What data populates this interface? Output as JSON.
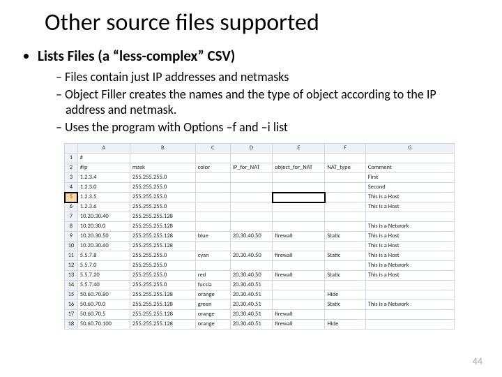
{
  "title": "Other source files supported",
  "bullet_main": "Lists Files (a “less-complex” CSV)",
  "sub_bullets": {
    "b1": "Files contain just IP addresses and netmasks",
    "b2": "Object Filler creates the names and the type of object according to the IP address and netmask.",
    "b3": "Uses the program with Options –f and –i list"
  },
  "page_number": "44",
  "sheet": {
    "cols": [
      "A",
      "B",
      "C",
      "D",
      "E",
      "F",
      "G"
    ],
    "row_numbers": [
      "1",
      "2",
      "3",
      "4",
      "5",
      "6",
      "7",
      "8",
      "9",
      "10",
      "11",
      "12",
      "13",
      "14",
      "15",
      "16",
      "17",
      "18"
    ],
    "selected_row_header": "5",
    "chart_data": {
      "type": "table",
      "columns": [
        "A",
        "B",
        "C",
        "D",
        "E",
        "F",
        "G"
      ],
      "rows": [
        {
          "A": "#",
          "B": "",
          "C": "",
          "D": "",
          "E": "",
          "F": "",
          "G": ""
        },
        {
          "A": "#ip",
          "B": "mask",
          "C": "color",
          "D": "IP_for_NAT",
          "E": "object_for_NAT",
          "F": "NAT_type",
          "G": "Comment"
        },
        {
          "A": "1.2.3.4",
          "B": "255.255.255.0",
          "C": "",
          "D": "",
          "E": "",
          "F": "",
          "G": "First"
        },
        {
          "A": "1.2.3.0",
          "B": "255.255.255.0",
          "C": "",
          "D": "",
          "E": "",
          "F": "",
          "G": "Second"
        },
        {
          "A": "1.2.3.5",
          "B": "255.255.255.0",
          "C": "",
          "D": "",
          "E": "",
          "F": "",
          "G": "This is a Host"
        },
        {
          "A": "1.2.3.6",
          "B": "255.255.255.0",
          "C": "",
          "D": "",
          "E": "",
          "F": "",
          "G": "This is a Host"
        },
        {
          "A": "10.20.30.40",
          "B": "255.255.255.128",
          "C": "",
          "D": "",
          "E": "",
          "F": "",
          "G": ""
        },
        {
          "A": "10.20.30.0",
          "B": "255.255.255.128",
          "C": "",
          "D": "",
          "E": "",
          "F": "",
          "G": "This is a Network"
        },
        {
          "A": "10.20.30.50",
          "B": "255.255.255.128",
          "C": "blue",
          "D": "20.30.40.50",
          "E": "firewall",
          "F": "Static",
          "G": "This is a Host"
        },
        {
          "A": "10.20.30.60",
          "B": "255.255.255.128",
          "C": "",
          "D": "",
          "E": "",
          "F": "",
          "G": "This is a Host"
        },
        {
          "A": "5.5.7.8",
          "B": "255.255.255.0",
          "C": "cyan",
          "D": "20.30.40.50",
          "E": "firewall",
          "F": "Static",
          "G": "This is a Host"
        },
        {
          "A": "5.5.7.0",
          "B": "255.255.255.0",
          "C": "",
          "D": "",
          "E": "",
          "F": "",
          "G": "This is a Network"
        },
        {
          "A": "5.5.7.20",
          "B": "255.255.255.0",
          "C": "red",
          "D": "20.30.40.50",
          "E": "firewall",
          "F": "Static",
          "G": "This is a Host"
        },
        {
          "A": "5.5.7.40",
          "B": "255.255.255.0",
          "C": "fucsia",
          "D": "20.30.40.51",
          "E": "",
          "F": "",
          "G": ""
        },
        {
          "A": "50.60.70.80",
          "B": "255.255.255.128",
          "C": "orange",
          "D": "20.30.40.51",
          "E": "",
          "F": "Hide",
          "G": ""
        },
        {
          "A": "50.60.70.0",
          "B": "255.255.255.128",
          "C": "green",
          "D": "20.30.40.51",
          "E": "",
          "F": "Static",
          "G": "This is a Network"
        },
        {
          "A": "50.60.70.5",
          "B": "255.255.255.128",
          "C": "orange",
          "D": "20.30.40.51",
          "E": "firewall",
          "F": "",
          "G": ""
        },
        {
          "A": "50.60.70.100",
          "B": "255.255.255.128",
          "C": "orange",
          "D": "20.30.40.51",
          "E": "firewall",
          "F": "Hide",
          "G": ""
        }
      ]
    }
  }
}
